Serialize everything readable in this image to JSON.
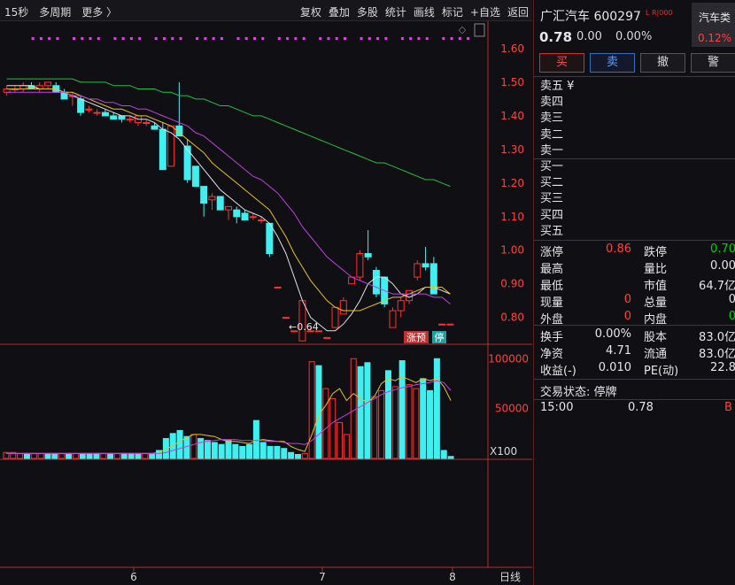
{
  "toolbar": {
    "left": [
      "15秒",
      "多周期",
      "更多 〉"
    ],
    "right": [
      "复权",
      "叠加",
      "多股",
      "统计",
      "画线",
      "标记",
      "+自选",
      "返回"
    ]
  },
  "chart_data": [
    {
      "type": "candlestick",
      "yaxis_ticks": [
        "1.60",
        "1.50",
        "1.40",
        "1.30",
        "1.20",
        "1.10",
        "1.00",
        "0.90",
        "0.80"
      ],
      "ylim": [
        0.72,
        1.65
      ],
      "x_ticks": [
        "6",
        "7",
        "8"
      ],
      "period_label": "日线",
      "candles": [
        {
          "o": 1.47,
          "h": 1.49,
          "l": 1.46,
          "c": 1.48
        },
        {
          "o": 1.48,
          "h": 1.49,
          "l": 1.47,
          "c": 1.48
        },
        {
          "o": 1.48,
          "h": 1.5,
          "l": 1.47,
          "c": 1.49
        },
        {
          "o": 1.49,
          "h": 1.5,
          "l": 1.48,
          "c": 1.48
        },
        {
          "o": 1.48,
          "h": 1.5,
          "l": 1.47,
          "c": 1.49
        },
        {
          "o": 1.49,
          "h": 1.5,
          "l": 1.48,
          "c": 1.5
        },
        {
          "o": 1.49,
          "h": 1.5,
          "l": 1.47,
          "c": 1.47
        },
        {
          "o": 1.47,
          "h": 1.48,
          "l": 1.45,
          "c": 1.45
        },
        {
          "o": 1.46,
          "h": 1.47,
          "l": 1.43,
          "c": 1.46
        },
        {
          "o": 1.45,
          "h": 1.46,
          "l": 1.4,
          "c": 1.41
        },
        {
          "o": 1.42,
          "h": 1.43,
          "l": 1.41,
          "c": 1.42
        },
        {
          "o": 1.41,
          "h": 1.42,
          "l": 1.4,
          "c": 1.41
        },
        {
          "o": 1.41,
          "h": 1.42,
          "l": 1.4,
          "c": 1.4
        },
        {
          "o": 1.4,
          "h": 1.41,
          "l": 1.39,
          "c": 1.39
        },
        {
          "o": 1.4,
          "h": 1.4,
          "l": 1.38,
          "c": 1.39
        },
        {
          "o": 1.39,
          "h": 1.4,
          "l": 1.38,
          "c": 1.39
        },
        {
          "o": 1.38,
          "h": 1.4,
          "l": 1.37,
          "c": 1.4
        },
        {
          "o": 1.38,
          "h": 1.39,
          "l": 1.37,
          "c": 1.38
        },
        {
          "o": 1.37,
          "h": 1.38,
          "l": 1.36,
          "c": 1.36
        },
        {
          "o": 1.36,
          "h": 1.38,
          "l": 1.24,
          "c": 1.24
        },
        {
          "o": 1.25,
          "h": 1.37,
          "l": 1.25,
          "c": 1.37
        },
        {
          "o": 1.37,
          "h": 1.5,
          "l": 1.36,
          "c": 1.34
        },
        {
          "o": 1.31,
          "h": 1.33,
          "l": 1.2,
          "c": 1.21
        },
        {
          "o": 1.25,
          "h": 1.25,
          "l": 1.19,
          "c": 1.19
        },
        {
          "o": 1.19,
          "h": 1.19,
          "l": 1.1,
          "c": 1.14
        },
        {
          "o": 1.15,
          "h": 1.17,
          "l": 1.12,
          "c": 1.16
        },
        {
          "o": 1.16,
          "h": 1.16,
          "l": 1.12,
          "c": 1.12
        },
        {
          "o": 1.12,
          "h": 1.13,
          "l": 1.09,
          "c": 1.13
        },
        {
          "o": 1.12,
          "h": 1.13,
          "l": 1.08,
          "c": 1.1
        },
        {
          "o": 1.11,
          "h": 1.12,
          "l": 1.09,
          "c": 1.09
        },
        {
          "o": 1.1,
          "h": 1.11,
          "l": 1.09,
          "c": 1.1
        },
        {
          "o": 1.09,
          "h": 1.1,
          "l": 1.08,
          "c": 1.09
        },
        {
          "o": 1.08,
          "h": 1.08,
          "l": 0.98,
          "c": 0.99
        },
        {
          "o": 0.89,
          "h": 0.89,
          "l": 0.89,
          "c": 0.89
        },
        {
          "o": 0.8,
          "h": 0.8,
          "l": 0.8,
          "c": 0.8
        },
        {
          "o": 0.76,
          "h": 0.76,
          "l": 0.76,
          "c": 0.76
        },
        {
          "o": 0.73,
          "h": 0.85,
          "l": 0.73,
          "c": 0.85
        },
        {
          "o": 0.76,
          "h": 0.77,
          "l": 0.76,
          "c": 0.76
        },
        {
          "o": 0.76,
          "h": 0.76,
          "l": 0.76,
          "c": 0.76
        },
        {
          "o": 0.74,
          "h": 0.74,
          "l": 0.74,
          "c": 0.74
        },
        {
          "o": 0.77,
          "h": 0.83,
          "l": 0.77,
          "c": 0.83
        },
        {
          "o": 0.81,
          "h": 0.86,
          "l": 0.81,
          "c": 0.85
        },
        {
          "o": 0.9,
          "h": 0.92,
          "l": 0.9,
          "c": 0.92
        },
        {
          "o": 0.92,
          "h": 1.0,
          "l": 0.91,
          "c": 0.99
        },
        {
          "o": 0.99,
          "h": 1.06,
          "l": 0.97,
          "c": 0.98
        },
        {
          "o": 0.94,
          "h": 0.95,
          "l": 0.86,
          "c": 0.87
        },
        {
          "o": 0.92,
          "h": 0.92,
          "l": 0.83,
          "c": 0.84
        },
        {
          "o": 0.77,
          "h": 0.83,
          "l": 0.77,
          "c": 0.82
        },
        {
          "o": 0.82,
          "h": 0.86,
          "l": 0.8,
          "c": 0.85
        },
        {
          "o": 0.85,
          "h": 0.88,
          "l": 0.84,
          "c": 0.88
        },
        {
          "o": 0.92,
          "h": 0.97,
          "l": 0.91,
          "c": 0.96
        },
        {
          "o": 0.96,
          "h": 1.01,
          "l": 0.94,
          "c": 0.95
        },
        {
          "o": 0.96,
          "h": 0.98,
          "l": 0.87,
          "c": 0.87
        },
        {
          "o": 0.78,
          "h": 0.78,
          "l": 0.78,
          "c": 0.78
        },
        {
          "o": 0.78,
          "h": 0.78,
          "l": 0.78,
          "c": 0.78
        }
      ],
      "ma_lines": [
        {
          "color": "#e0e0e0",
          "values": [
            1.49,
            1.49,
            1.49,
            1.49,
            1.48,
            1.48,
            1.48,
            1.47,
            1.46,
            1.45,
            1.44,
            1.43,
            1.42,
            1.41,
            1.4,
            1.4,
            1.39,
            1.39,
            1.38,
            1.36,
            1.35,
            1.33,
            1.3,
            1.27,
            1.24,
            1.21,
            1.18,
            1.16,
            1.14,
            1.12,
            1.11,
            1.1,
            1.08,
            1.04,
            0.99,
            0.92,
            0.85,
            0.8,
            0.78,
            0.76,
            0.76,
            0.78,
            0.81,
            0.85,
            0.9,
            0.92,
            0.92,
            0.9,
            0.87,
            0.86,
            0.87,
            0.89,
            0.89,
            0.88,
            0.87
          ]
        },
        {
          "color": "#e8c020",
          "values": [
            1.48,
            1.48,
            1.48,
            1.48,
            1.48,
            1.48,
            1.48,
            1.47,
            1.47,
            1.46,
            1.45,
            1.44,
            1.43,
            1.42,
            1.42,
            1.41,
            1.4,
            1.4,
            1.39,
            1.38,
            1.37,
            1.35,
            1.33,
            1.31,
            1.29,
            1.26,
            1.24,
            1.22,
            1.2,
            1.18,
            1.16,
            1.14,
            1.12,
            1.08,
            1.04,
            0.99,
            0.95,
            0.91,
            0.88,
            0.85,
            0.83,
            0.82,
            0.82,
            0.82,
            0.83,
            0.84,
            0.85,
            0.86,
            0.86,
            0.87,
            0.88,
            0.89,
            0.89,
            0.89,
            0.87
          ]
        },
        {
          "color": "#c040e0",
          "values": [
            1.47,
            1.47,
            1.47,
            1.47,
            1.47,
            1.47,
            1.47,
            1.47,
            1.46,
            1.46,
            1.45,
            1.45,
            1.44,
            1.44,
            1.43,
            1.43,
            1.42,
            1.42,
            1.41,
            1.4,
            1.39,
            1.38,
            1.37,
            1.35,
            1.34,
            1.32,
            1.3,
            1.28,
            1.26,
            1.24,
            1.22,
            1.21,
            1.19,
            1.17,
            1.14,
            1.11,
            1.07,
            1.04,
            1.01,
            0.98,
            0.96,
            0.94,
            0.92,
            0.91,
            0.9,
            0.89,
            0.88,
            0.87,
            0.87,
            0.87,
            0.87,
            0.87,
            0.86,
            0.86,
            0.84
          ]
        },
        {
          "color": "#20c040",
          "values": [
            1.51,
            1.51,
            1.51,
            1.51,
            1.51,
            1.51,
            1.51,
            1.51,
            1.51,
            1.5,
            1.5,
            1.5,
            1.5,
            1.49,
            1.49,
            1.49,
            1.48,
            1.48,
            1.48,
            1.47,
            1.47,
            1.46,
            1.46,
            1.45,
            1.45,
            1.44,
            1.43,
            1.43,
            1.42,
            1.41,
            1.4,
            1.4,
            1.39,
            1.38,
            1.37,
            1.36,
            1.35,
            1.34,
            1.33,
            1.32,
            1.31,
            1.3,
            1.29,
            1.28,
            1.27,
            1.26,
            1.26,
            1.25,
            1.24,
            1.23,
            1.22,
            1.21,
            1.21,
            1.2,
            1.19
          ]
        }
      ],
      "annotation": "←0.64",
      "badges": [
        "涨预",
        "停"
      ]
    },
    {
      "type": "bar",
      "yaxis_ticks": [
        "100000",
        "50000"
      ],
      "ylim": [
        0,
        110000
      ],
      "unit": "X100",
      "volumes": [
        6000,
        6000,
        5000,
        5000,
        5000,
        5000,
        5000,
        5000,
        5000,
        5000,
        5000,
        5000,
        5000,
        5000,
        5000,
        5000,
        5000,
        5000,
        5000,
        5000,
        5000,
        5000,
        8000,
        20000,
        25000,
        28000,
        22000,
        24000,
        20000,
        18000,
        16000,
        14000,
        18000,
        14000,
        12000,
        14000,
        38000,
        16000,
        12000,
        12000,
        10000,
        6000,
        4000,
        5000,
        97000,
        93000,
        70000,
        60000,
        36000,
        24000,
        100000,
        92000,
        96000,
        62000,
        68000,
        88000,
        72000,
        98000,
        74000,
        70000,
        80000,
        68000,
        100000,
        8000,
        2000
      ],
      "vol_up": [
        true,
        true,
        true,
        false,
        true,
        true,
        false,
        false,
        true,
        false,
        true,
        false,
        false,
        false,
        true,
        false,
        true,
        false,
        false,
        false,
        true,
        false,
        false,
        false,
        false,
        false,
        false,
        true,
        false,
        false,
        false,
        false,
        false,
        false,
        false,
        false,
        false,
        false,
        false,
        false,
        false,
        false,
        false,
        true,
        true,
        false,
        true,
        true,
        true,
        true,
        true,
        false,
        false,
        true,
        true,
        false,
        true,
        false,
        true,
        true,
        false,
        false,
        false,
        false,
        false
      ],
      "ma_lines": [
        {
          "color": "#e8c020",
          "values": [
            5000,
            5000,
            5000,
            5000,
            5000,
            5000,
            5000,
            5000,
            5000,
            5000,
            5000,
            5000,
            5000,
            5000,
            5000,
            5000,
            5000,
            5000,
            5000,
            5000,
            5000,
            5000,
            6000,
            9000,
            13000,
            17000,
            21000,
            24000,
            24000,
            23000,
            22000,
            19000,
            17000,
            17000,
            16000,
            15000,
            18000,
            19000,
            18000,
            17000,
            17000,
            12000,
            9000,
            7000,
            24000,
            44000,
            53000,
            65000,
            70000,
            58000,
            65000,
            60000,
            56000,
            62000,
            75000,
            80000,
            78000,
            82000,
            79000,
            76000,
            80000,
            78000,
            80000,
            72000,
            58000
          ]
        },
        {
          "color": "#c040e0",
          "values": [
            5000,
            5000,
            5000,
            5000,
            5000,
            5000,
            5000,
            5000,
            5000,
            5000,
            5000,
            5000,
            5000,
            5000,
            5000,
            5000,
            5000,
            5000,
            5000,
            5000,
            5000,
            5000,
            5000,
            6000,
            8000,
            10000,
            12000,
            14000,
            16000,
            17000,
            18000,
            19000,
            19000,
            19000,
            18000,
            18000,
            18000,
            18000,
            17000,
            17000,
            16000,
            15000,
            15000,
            14000,
            18000,
            24000,
            30000,
            36000,
            40000,
            44000,
            48000,
            52000,
            56000,
            60000,
            64000,
            67000,
            69000,
            71000,
            72000,
            74000,
            75000,
            76000,
            78000,
            76000,
            68000
          ]
        }
      ]
    }
  ],
  "quote": {
    "name_code": "广汇汽车 600297",
    "flag": "L R|000",
    "sector_name": "汽车类",
    "sector_pct": "0.12%",
    "price": "0.78",
    "change": "0.00",
    "pct": "0.00%",
    "actions": [
      "买",
      "卖",
      "撤",
      "警"
    ],
    "sell_book": [
      "卖五 ¥",
      "卖四",
      "卖三",
      "卖二",
      "卖一"
    ],
    "buy_book": [
      "买一",
      "买二",
      "买三",
      "买四",
      "买五"
    ],
    "stats1": [
      {
        "l": "涨停",
        "v": "0.86",
        "vc": "red",
        "r": "跌停",
        "rv": "0.70",
        "rc": "green"
      },
      {
        "l": "最高",
        "v": "",
        "vc": "white",
        "r": "量比",
        "rv": "0.00",
        "rc": "white"
      },
      {
        "l": "最低",
        "v": "",
        "vc": "white",
        "r": "市值",
        "rv": "64.7亿",
        "rc": "white"
      },
      {
        "l": "现量",
        "v": "0",
        "vc": "red",
        "r": "总量",
        "rv": "0",
        "rc": "white"
      },
      {
        "l": "外盘",
        "v": "0",
        "vc": "red",
        "r": "内盘",
        "rv": "0",
        "rc": "green"
      }
    ],
    "stats2": [
      {
        "l": "换手",
        "v": "0.00%",
        "vc": "white",
        "r": "股本",
        "rv": "83.0亿",
        "rc": "white"
      },
      {
        "l": "净资",
        "v": "4.71",
        "vc": "white",
        "r": "流通",
        "rv": "83.0亿",
        "rc": "white"
      },
      {
        "l": "收益(-)",
        "v": "0.010",
        "vc": "white",
        "r": "PE(动)",
        "rv": "22.8",
        "rc": "white"
      }
    ],
    "trade_status": "交易状态: 停牌",
    "tick": {
      "time": "15:00",
      "price": "0.78",
      "side": "B"
    }
  }
}
